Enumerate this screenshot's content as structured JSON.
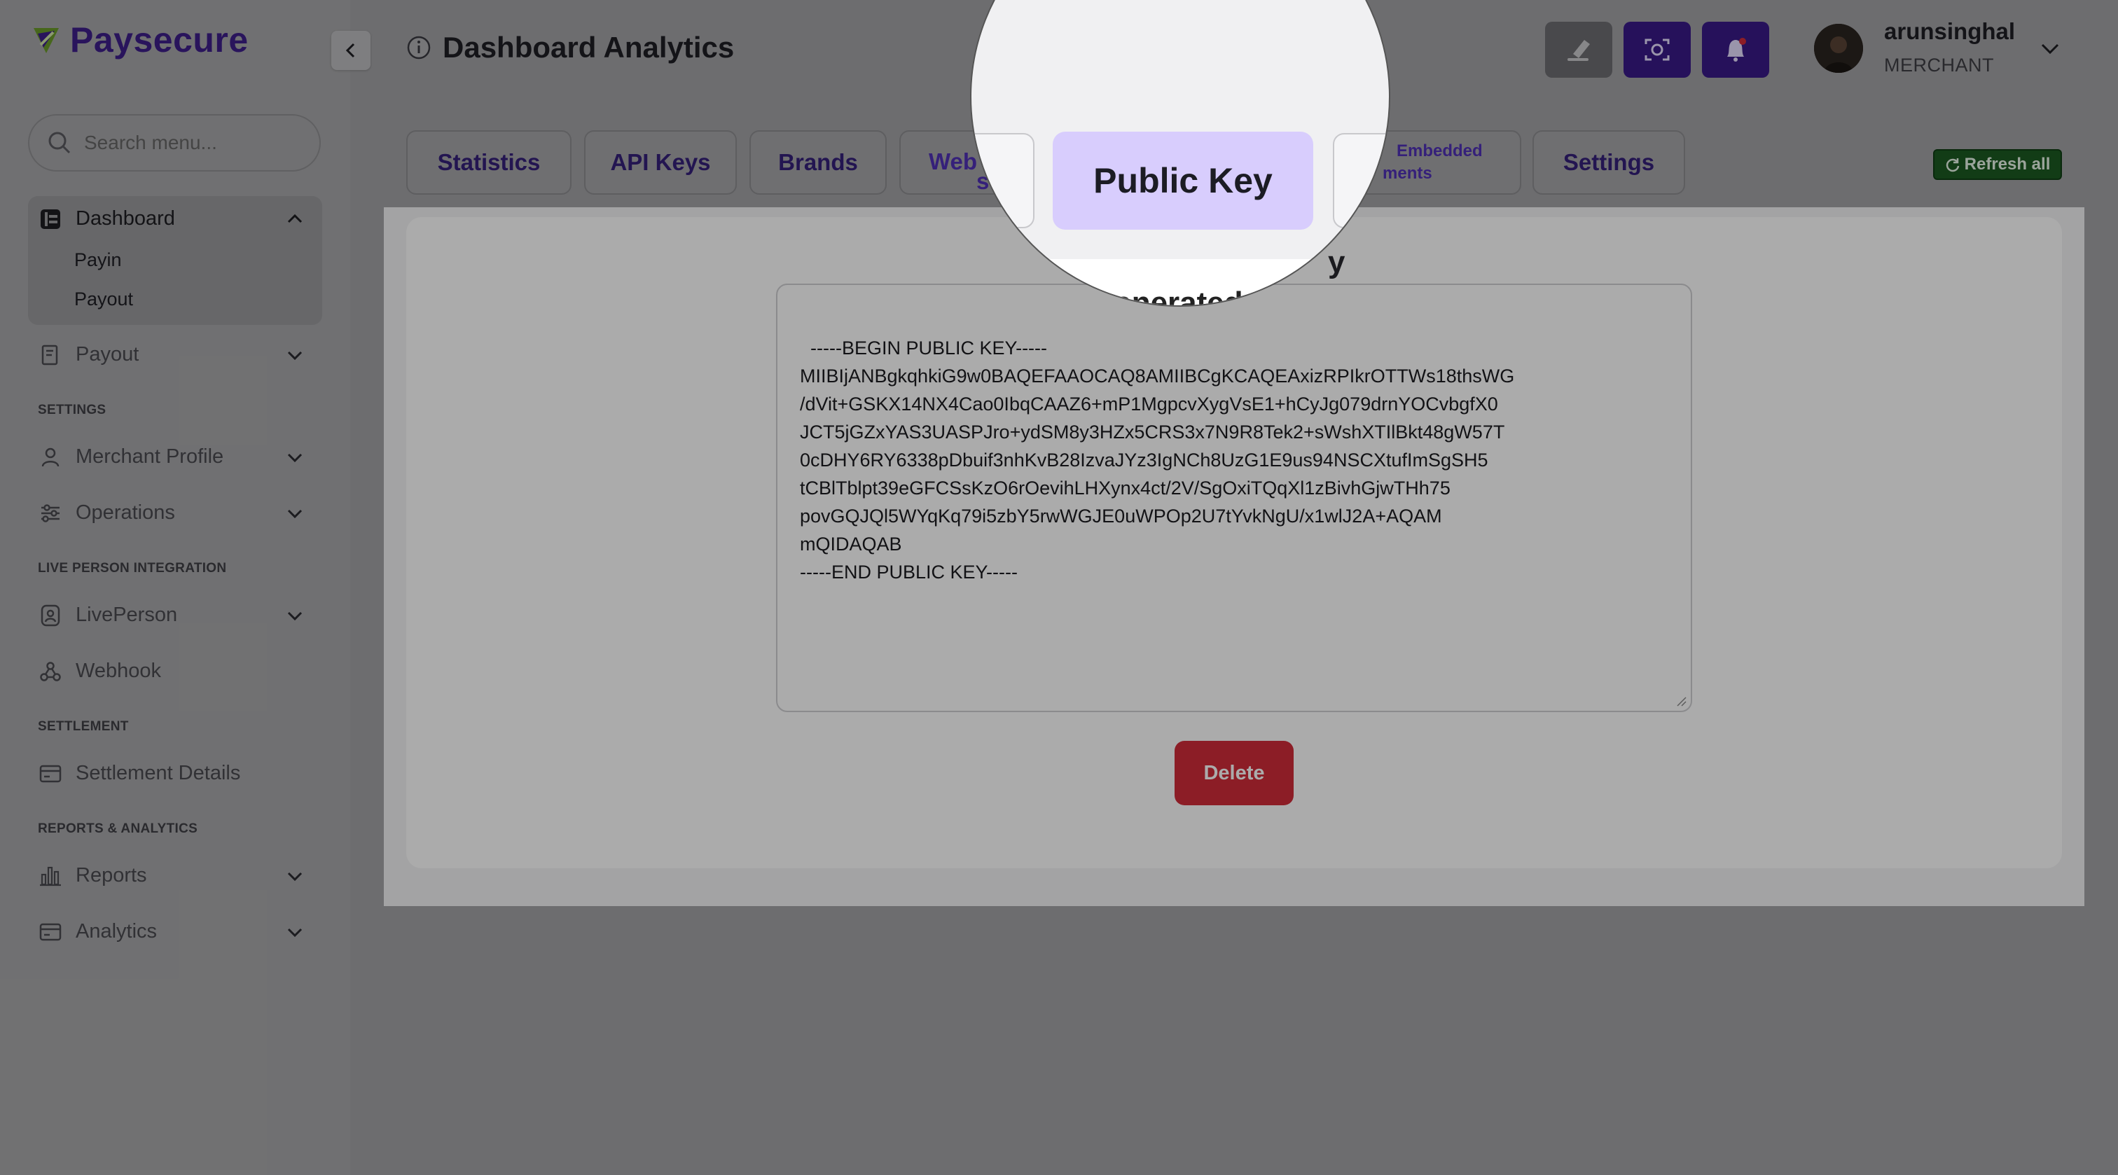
{
  "app": {
    "name": "Paysecure"
  },
  "sidebar": {
    "search_placeholder": "Search menu...",
    "items": {
      "dashboard": "Dashboard",
      "payin": "Payin",
      "payout_sub": "Payout",
      "payout": "Payout",
      "merchant_profile": "Merchant Profile",
      "operations": "Operations",
      "liveperson": "LivePerson",
      "webhook": "Webhook",
      "settlement_details": "Settlement Details",
      "reports": "Reports",
      "analytics": "Analytics"
    },
    "sections": {
      "settings": "SETTINGS",
      "live_person": "LIVE PERSON INTEGRATION",
      "settlement": "SETTLEMENT",
      "reports": "REPORTS & ANALYTICS"
    }
  },
  "header": {
    "title": "Dashboard Analytics",
    "user": {
      "name": "arunsinghal",
      "role": "MERCHANT"
    }
  },
  "tabs": {
    "statistics": "Statistics",
    "api_keys": "API Keys",
    "brands": "Brands",
    "webhooks_partial": "Web",
    "webhooks_partial_tail": "s",
    "public_key": "Public Key",
    "embedded_top": "Embedded",
    "embedded_bottom": "ments",
    "settings": "Settings"
  },
  "refresh_label": "Refresh all",
  "content": {
    "heading_fragment": "Generated P",
    "heading_tail": "y",
    "public_key": "-----BEGIN PUBLIC KEY-----\nMIIBIjANBgkqhkiG9w0BAQEFAAOCAQ8AMIIBCgKCAQEAxizRPIkrOTTWs18thsWG\n/dVit+GSKX14NX4Cao0IbqCAAZ6+mP1MgpcvXygVsE1+hCyJg079drnYOCvbgfX0\nJCT5jGZxYAS3UASPJro+ydSM8y3HZx5CRS3x7N9R8Tek2+sWshXTIlBkt48gW57T\n0cDHY6RY6338pDbuif3nhKvB28IzvaJYz3IgNCh8UzG1E9us94NSCXtufImSgSH5\ntCBlTblpt39eGFCSsKzO6rOevihLHXynx4ct/2V/SgOxiTQqXl1zBivhGjwTHh75\npovGQJQl5WYqKq79i5zbY5rwWGJE0uWPOp2U7tYvkNgU/x1wlJ2A+AQAM\nmQIDAQAB\n-----END PUBLIC KEY-----",
    "delete_label": "Delete"
  }
}
